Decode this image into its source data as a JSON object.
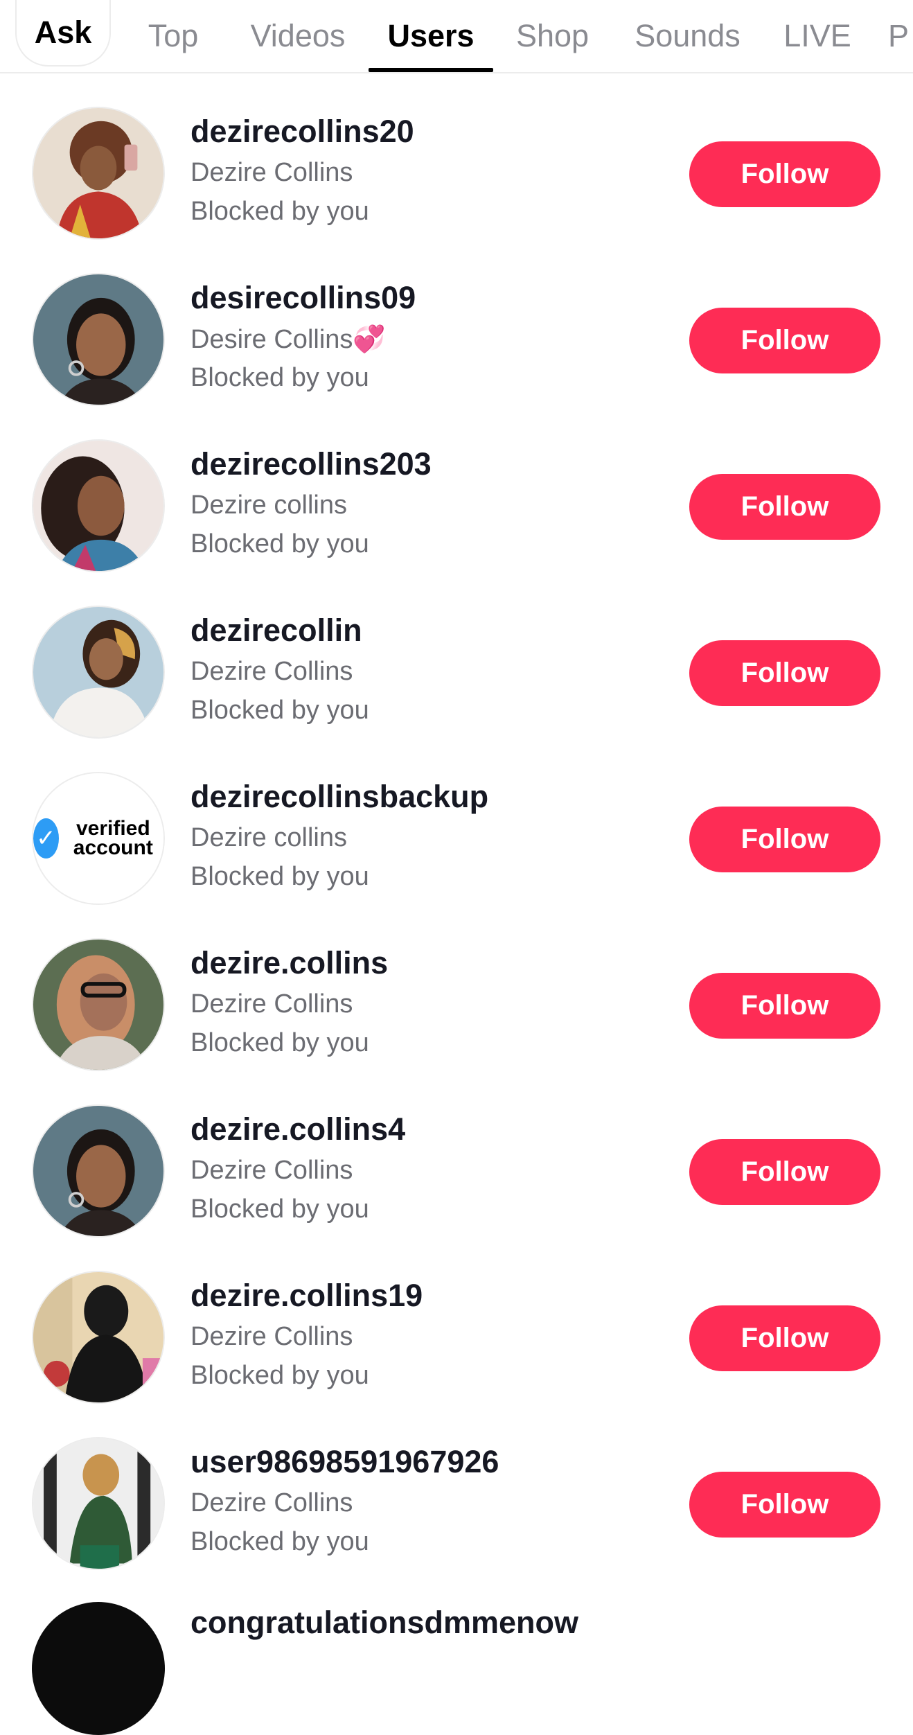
{
  "tabs": [
    {
      "label": "Ask"
    },
    {
      "label": "Top"
    },
    {
      "label": "Videos"
    },
    {
      "label": "Users"
    },
    {
      "label": "Shop"
    },
    {
      "label": "Sounds"
    },
    {
      "label": "LIVE"
    },
    {
      "label": "P"
    }
  ],
  "active_tab": "Users",
  "colors": {
    "follow_button": "#fe2c55",
    "active_tab_underline": "#000000",
    "muted_text": "#6b6c72"
  },
  "users": [
    {
      "username": "dezirecollins20",
      "display_name": "Dezire Collins",
      "status": "Blocked by you",
      "button": "Follow",
      "avatar": "photo"
    },
    {
      "username": "desirecollins09",
      "display_name": "Desire Collins💞",
      "status": "Blocked by you",
      "button": "Follow",
      "avatar": "photo"
    },
    {
      "username": "dezirecollins203",
      "display_name": "Dezire collins",
      "status": "Blocked by you",
      "button": "Follow",
      "avatar": "photo"
    },
    {
      "username": "dezirecollin",
      "display_name": "Dezire Collins",
      "status": "Blocked by you",
      "button": "Follow",
      "avatar": "photo"
    },
    {
      "username": "dezirecollinsbackup",
      "display_name": "Dezire collins",
      "status": "Blocked by you",
      "button": "Follow",
      "avatar": "verified-account-logo",
      "avatar_text": "verified account"
    },
    {
      "username": "dezire.collins",
      "display_name": "Dezire Collins",
      "status": "Blocked by you",
      "button": "Follow",
      "avatar": "photo"
    },
    {
      "username": "dezire.collins4",
      "display_name": "Dezire Collins",
      "status": "Blocked by you",
      "button": "Follow",
      "avatar": "photo"
    },
    {
      "username": "dezire.collins19",
      "display_name": "Dezire Collins",
      "status": "Blocked by you",
      "button": "Follow",
      "avatar": "photo"
    },
    {
      "username": "user98698591967926",
      "display_name": "Dezire Collins",
      "status": "Blocked by you",
      "button": "Follow",
      "avatar": "photo"
    }
  ],
  "partial_row": {
    "username": "congratulationsdmmenow"
  }
}
